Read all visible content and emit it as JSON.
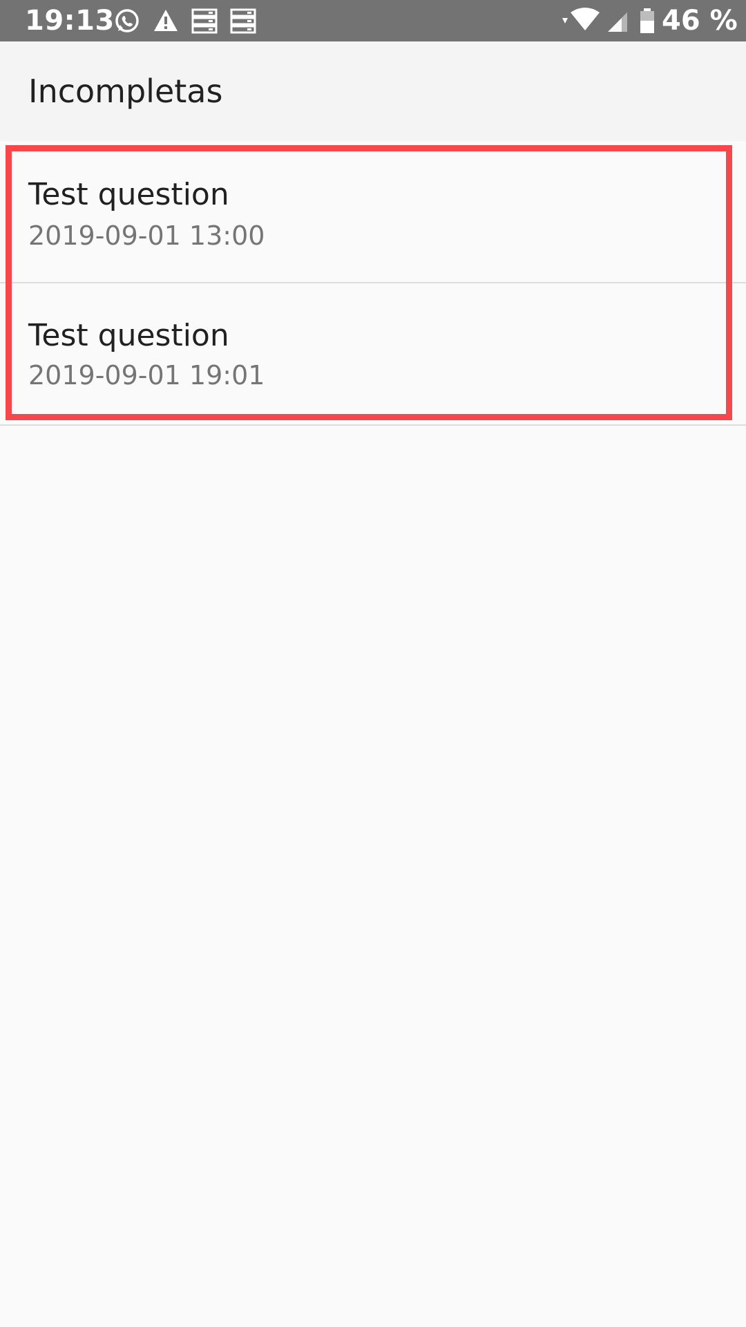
{
  "status_bar": {
    "time": "19:13",
    "icons_left": [
      "whatsapp-icon",
      "warning-icon",
      "server-icon",
      "server-icon"
    ],
    "icons_right": [
      "wifi-icon",
      "signal-icon",
      "battery-icon"
    ],
    "battery": "46 %"
  },
  "app_bar": {
    "title": "Incompletas"
  },
  "list": {
    "items": [
      {
        "title": "Test question",
        "date": "2019-09-01 13:00"
      },
      {
        "title": "Test question",
        "date": "2019-09-01 19:01"
      }
    ]
  },
  "colors": {
    "status_bar_bg": "#737373",
    "app_bar_bg": "#f4f4f4",
    "highlight": "#f5474c"
  }
}
